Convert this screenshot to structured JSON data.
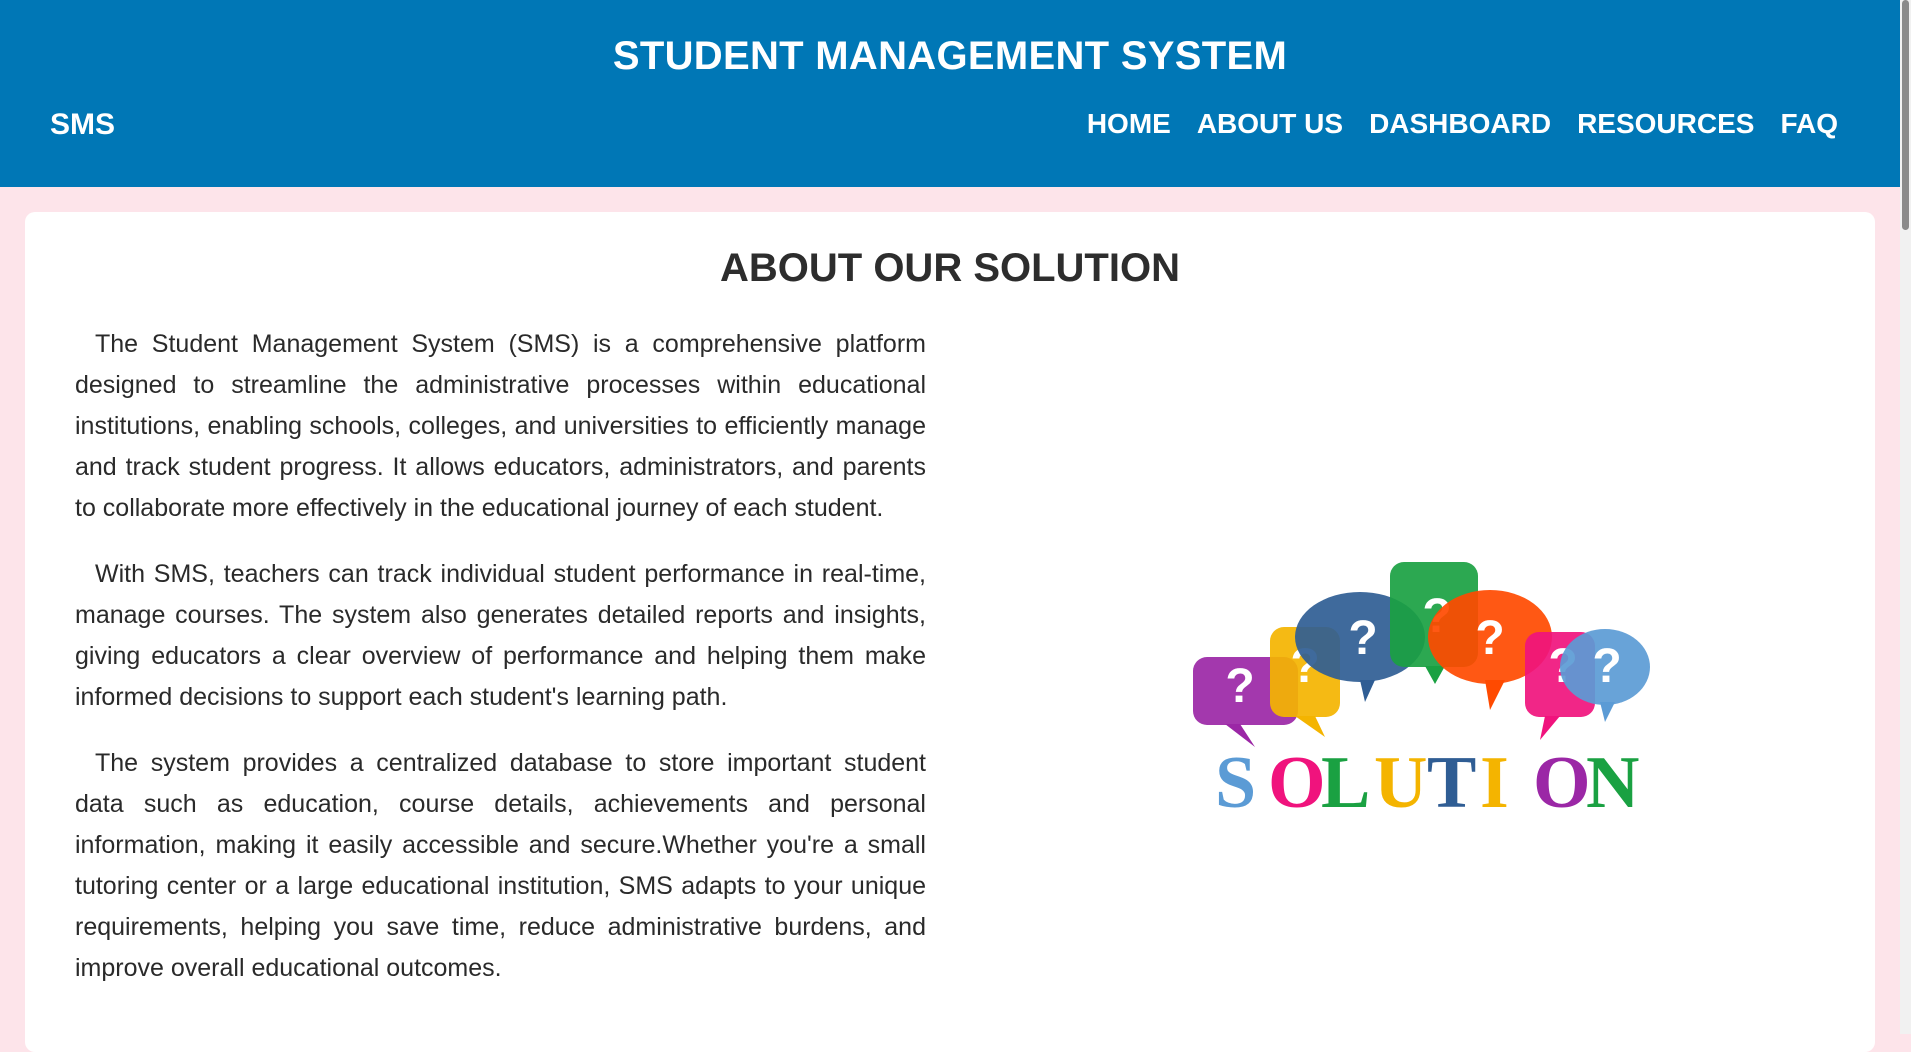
{
  "header": {
    "title": "STUDENT MANAGEMENT SYSTEM",
    "brand": "SMS",
    "nav": [
      "HOME",
      "ABOUT US",
      "DASHBOARD",
      "RESOURCES",
      "FAQ"
    ]
  },
  "main": {
    "title": "ABOUT OUR SOLUTION",
    "paragraphs": [
      "The Student Management System (SMS) is a comprehensive platform designed to streamline the administrative processes within educational institutions, enabling schools, colleges, and universities to efficiently manage and track student progress. It allows educators, administrators, and parents to collaborate more effectively in the educational journey of each student.",
      "With SMS, teachers can track individual student performance in real-time, manage courses. The system also generates detailed reports and insights, giving educators a clear overview of performance and helping them make informed decisions to support each student's learning path.",
      "The system provides a centralized database to store important student data such as education, course details, achievements and personal information, making it easily accessible and secure.Whether you're a small tutoring center or a large educational institution, SMS adapts to your unique requirements, helping you save time, reduce administrative burdens, and improve overall educational outcomes."
    ],
    "image": {
      "word": "SOLUTION",
      "icon": "question-speech-bubbles-icon",
      "bubble_colors": [
        "#9b27a6",
        "#f4b400",
        "#2f5d94",
        "#1aa142",
        "#ff4a00",
        "#f0137d",
        "#5b9bd5"
      ],
      "letter_colors": [
        "#5b9bd5",
        "#f0137d",
        "#1aa142",
        "#f4b400",
        "#2f5d94",
        "#f4b400",
        "#9b27a6",
        "#1aa142"
      ]
    }
  },
  "colors": {
    "header_bg": "#0077b6",
    "page_bg": "#fde4ea",
    "card_bg": "#ffffff"
  }
}
